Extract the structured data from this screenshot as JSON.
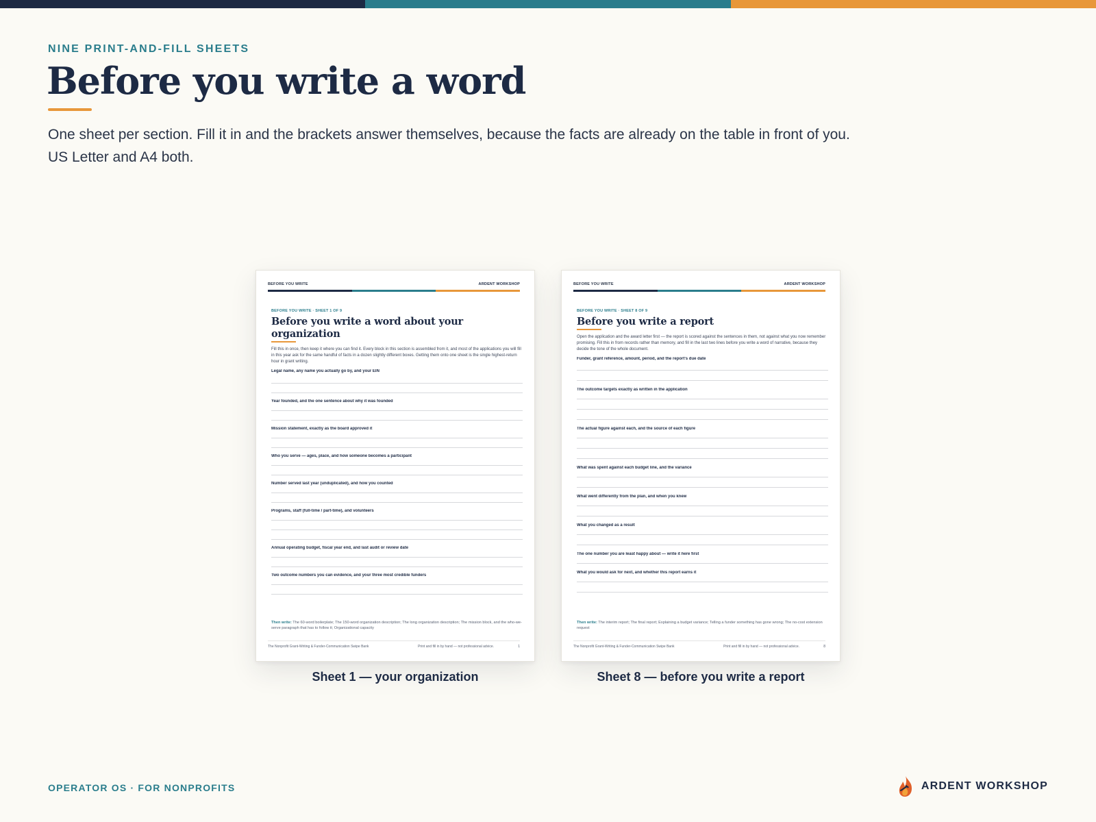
{
  "colors": {
    "navy": "#1d2a44",
    "teal": "#2a7d8c",
    "orange": "#e8973a",
    "background": "#fbfaf5"
  },
  "header": {
    "eyebrow": "NINE PRINT-AND-FILL SHEETS",
    "title": "Before you write a word",
    "lede": "One sheet per section. Fill it in and the brackets answer themselves, because the facts are already on the table in front of you. US Letter and A4 both."
  },
  "sheets": [
    {
      "header_left": "BEFORE YOU WRITE",
      "header_right": "ARDENT WORKSHOP",
      "eyebrow": "BEFORE YOU WRITE · SHEET 1 OF 9",
      "title": "Before you write a word about your organization",
      "intro": "Fill this in once, then keep it where you can find it. Every block in this section is assembled from it, and most of the applications you will fill in this year ask for the same handful of facts in a dozen slightly different boxes. Getting them onto one sheet is the single highest-return hour in grant writing.",
      "fields": [
        "Legal name, any name you actually go by, and your EIN",
        "Year founded, and the one sentence about why it was founded",
        "Mission statement, exactly as the board approved it",
        "Who you serve — ages, place, and how someone becomes a participant",
        "Number served last year (unduplicated), and how you counted",
        "Programs, staff (full-time / part-time), and volunteers",
        "Annual operating budget, fiscal year end, and last audit or review date",
        "Two outcome numbers you can evidence, and your three most credible funders"
      ],
      "then_label": "Then write:",
      "then_text": "The 60-word boilerplate; The 150-word organization description; The long organization description; The mission block, and the who-we-serve paragraph that has to follow it; Organizational capacity",
      "footer_left": "The Nonprofit Grant-Writing & Funder-Communication Swipe Bank",
      "footer_mid": "Print and fill in by hand — not professional advice.",
      "page": "1",
      "caption": "Sheet 1 — your organization"
    },
    {
      "header_left": "BEFORE YOU WRITE",
      "header_right": "ARDENT WORKSHOP",
      "eyebrow": "BEFORE YOU WRITE · SHEET 8 OF 9",
      "title": "Before you write a report",
      "intro": "Open the application and the award letter first — the report is scored against the sentences in them, not against what you now remember promising. Fill this in from records rather than memory, and fill in the last two lines before you write a word of narrative, because they decide the tone of the whole document.",
      "fields": [
        "Funder, grant reference, amount, period, and the report's due date",
        "The outcome targets exactly as written in the application",
        "The actual figure against each, and the source of each figure",
        "What was spent against each budget line, and the variance",
        "What went differently from the plan, and when you knew",
        "What you changed as a result",
        "The one number you are least happy about — write it here first",
        "What you would ask for next, and whether this report earns it"
      ],
      "then_label": "Then write:",
      "then_text": "The interim report; The final report; Explaining a budget variance; Telling a funder something has gone wrong; The no-cost extension request",
      "footer_left": "The Nonprofit Grant-Writing & Funder-Communication Swipe Bank",
      "footer_mid": "Print and fill in by hand — not professional advice.",
      "page": "8",
      "caption": "Sheet 8 — before you write a report"
    }
  ],
  "footer": {
    "left": "OPERATOR OS · FOR NONPROFITS",
    "brand": "ARDENT WORKSHOP",
    "brand_icon": "flame-logo-icon"
  }
}
